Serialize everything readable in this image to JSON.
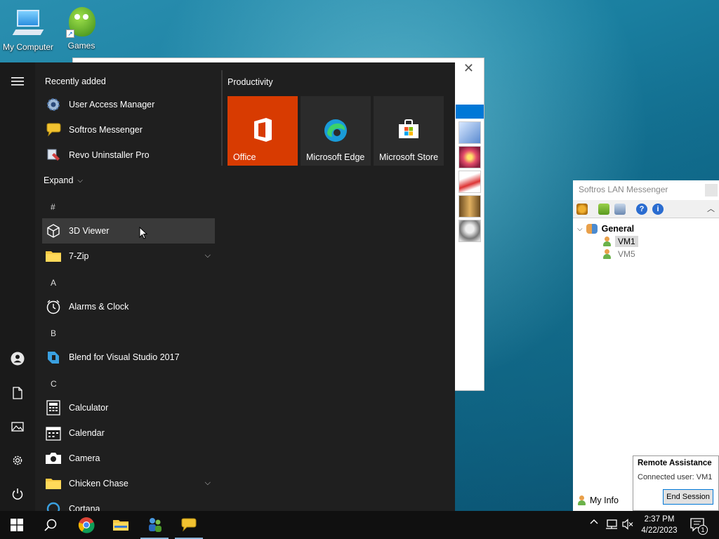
{
  "desktop": {
    "icons": [
      {
        "label": "My Computer",
        "icon": "computer-icon"
      },
      {
        "label": "Games",
        "icon": "games-icon"
      }
    ]
  },
  "start_menu": {
    "recently_added_title": "Recently added",
    "recent": [
      {
        "label": "User Access Manager",
        "icon": "gear-icon"
      },
      {
        "label": "Softros Messenger",
        "icon": "chat-bubble-icon"
      },
      {
        "label": "Revo Uninstaller Pro",
        "icon": "uninstaller-icon"
      }
    ],
    "expand_label": "Expand",
    "sections": {
      "hash": "#",
      "a": "A",
      "b": "B",
      "c": "C"
    },
    "apps": {
      "viewer3d": "3D Viewer",
      "zip": "7-Zip",
      "alarms": "Alarms & Clock",
      "blend": "Blend for Visual Studio 2017",
      "calculator": "Calculator",
      "calendar": "Calendar",
      "camera": "Camera",
      "chicken": "Chicken Chase",
      "cortana": "Cortana"
    },
    "tiles_title": "Productivity",
    "tiles": [
      {
        "label": "Office",
        "color": "#d83b01"
      },
      {
        "label": "Microsoft Edge",
        "color": "#2b2b2b"
      },
      {
        "label": "Microsoft Store",
        "color": "#2b2b2b"
      }
    ]
  },
  "messenger": {
    "title": "Softros LAN Messenger",
    "group": "General",
    "users": [
      "VM1",
      "VM5"
    ],
    "my_info": "My Info"
  },
  "remote_assistance": {
    "title": "Remote Assistance",
    "connected": "Connected user:  VM1",
    "end_button": "End Session"
  },
  "taskbar": {
    "time": "2:37 PM",
    "date": "4/22/2023",
    "notification_count": "1",
    "accent": "#0078d7"
  }
}
